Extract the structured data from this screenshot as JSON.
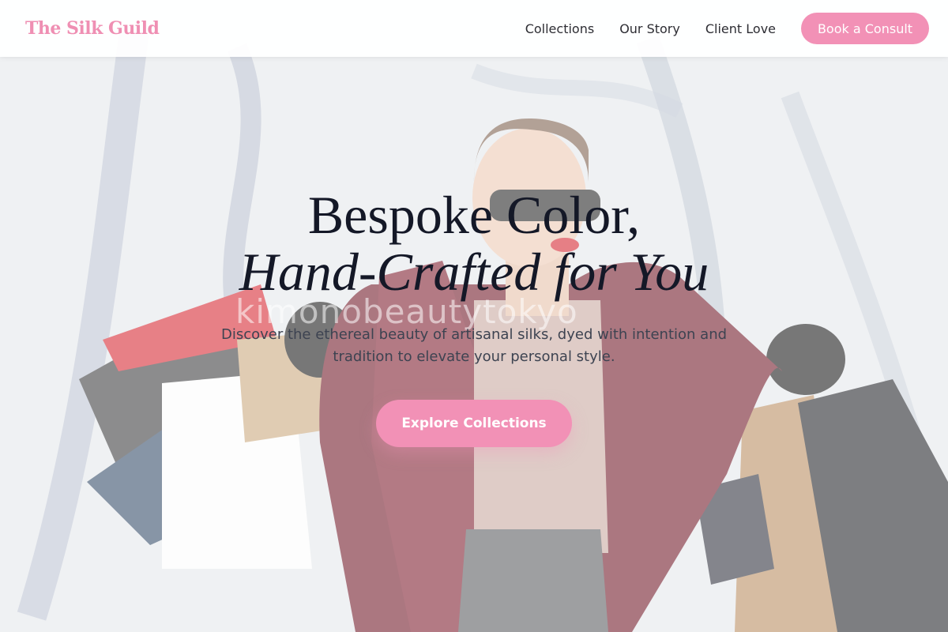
{
  "header": {
    "brand": "The Silk Guild",
    "nav": [
      "Collections",
      "Our Story",
      "Client Love"
    ],
    "cta_label": "Book a Consult"
  },
  "hero": {
    "title_line1": "Bespoke Color,",
    "title_line2": "Hand-Crafted for You",
    "subtitle": "Discover the ethereal beauty of artisanal silks, dyed with intention and tradition to elevate your personal style.",
    "cta_label": "Explore Collections",
    "background_watermark": "kimonobeautytokyo"
  },
  "colors": {
    "accent": "#f291b6",
    "brand": "#ef8fb3",
    "heading": "#141827",
    "body_text": "#3d4351"
  }
}
